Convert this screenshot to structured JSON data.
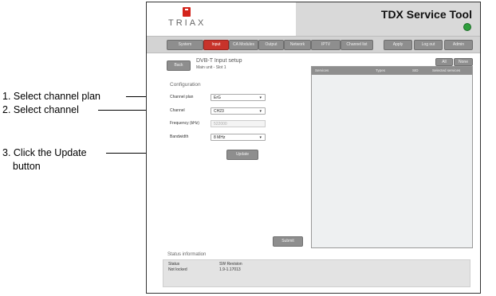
{
  "annotations": {
    "step1": "1. Select channel plan",
    "step2": "2. Select channel",
    "step3_line1": "3. Click the Update",
    "step3_line2": "button"
  },
  "header": {
    "logo_text": "TRIAX",
    "tool_title": "TDX Service Tool"
  },
  "nav": {
    "tabs": [
      "System",
      "Input",
      "CA Modules",
      "Output",
      "Network",
      "IPTV",
      "Channel list"
    ],
    "active_tab": "Input",
    "right_buttons": [
      "Apply",
      "Log out",
      "Admin"
    ]
  },
  "page": {
    "back_label": "Back",
    "title": "DVB-T Input setup",
    "subtitle": "Main unit - Slot 1"
  },
  "config": {
    "heading": "Configuration",
    "channel_plan_label": "Channel plan",
    "channel_plan_value": "ErG",
    "channel_label": "Channel",
    "channel_value": "CH23",
    "frequency_label": "Frequency (kHz)",
    "frequency_value": "522000",
    "bandwidth_label": "Bandwidth",
    "bandwidth_value": "8 MHz",
    "update_label": "Update"
  },
  "services": {
    "all_label": "All",
    "none_label": "None",
    "columns": [
      "Services",
      "Types",
      "SID",
      "Selected services"
    ],
    "submit_label": "Submit"
  },
  "status": {
    "heading": "Status information",
    "status_label": "Status",
    "status_value": "Not locked",
    "sw_label": "SW Revision",
    "sw_value": "1.9-1.17013"
  },
  "colors": {
    "accent": "#c8332b",
    "led": "#2e9e3c"
  }
}
